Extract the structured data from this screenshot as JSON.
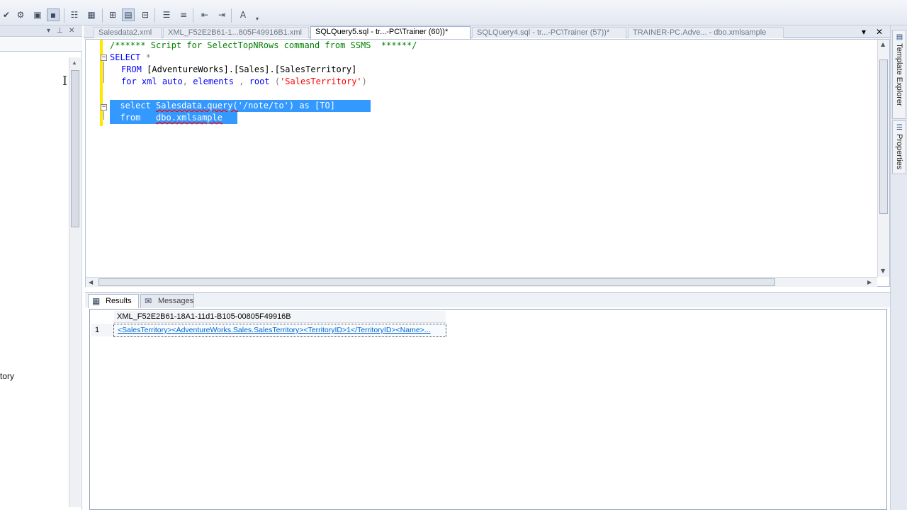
{
  "toolbar": {
    "icons": [
      "check-icon",
      "parse-icon",
      "include-plan-icon",
      "save-results-icon",
      "results-to-text-icon",
      "results-to-grid-icon",
      "results-to-file-icon",
      "comment-icon",
      "uncomment-icon",
      "decrease-indent-icon",
      "increase-indent-icon",
      "specify-values-icon"
    ]
  },
  "left_panel": {
    "tree_text": "tory"
  },
  "tabs": [
    {
      "label": "Salesdata2.xml"
    },
    {
      "label": "XML_F52E2B61-1...805F49916B1.xml"
    },
    {
      "label": "SQLQuery5.sql - tr...-PC\\Trainer (60))*"
    },
    {
      "label": "SQLQuery4.sql - tr...-PC\\Trainer (57))*"
    },
    {
      "label": "TRAINER-PC.Adve... - dbo.xmlsample"
    }
  ],
  "editor": {
    "line1": "/****** Script for SelectTopNRows command from SSMS  ******/",
    "line2_kw": "SELECT",
    "line2_rest": " *",
    "line3_kw": "FROM",
    "line3_rest": " [AdventureWorks].[Sales].[SalesTerritory]",
    "line4_kw1": "for xml",
    "line4_kw2": "auto",
    "line4_kw3": "elements",
    "line4_kw4": "root",
    "line4_str": "'SalesTerritory'",
    "line5_kw": "select",
    "line5_obj": "Salesdata.query(",
    "line5_str": "'/note/to'",
    "line5_as": "as",
    "line5_alias": "[TO]",
    "line6_kw": "from",
    "line6_obj": "dbo.xmlsample"
  },
  "results": {
    "tabs": [
      {
        "label": "Results"
      },
      {
        "label": "Messages"
      }
    ],
    "column_header": "XML_F52E2B61-18A1-11d1-B105-00805F49916B",
    "rows": [
      {
        "num": "1",
        "value": "<SalesTerritory><AdventureWorks.Sales.SalesTerritory><TerritoryID>1</TerritoryID><Name>..."
      }
    ]
  },
  "right_strip": {
    "tabs": [
      {
        "label": "Template Explorer"
      },
      {
        "label": "Properties"
      }
    ]
  }
}
